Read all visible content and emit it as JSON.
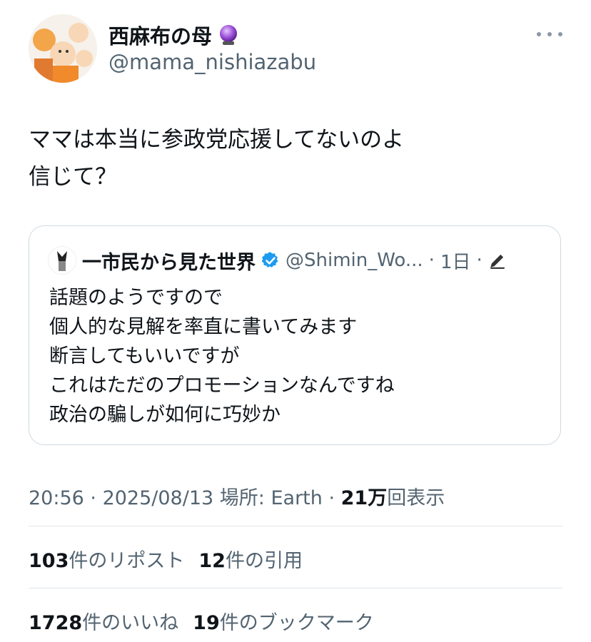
{
  "author": {
    "display_name": "西麻布の母",
    "handle": "@mama_nishiazabu",
    "emoji_icon": "crystal-ball-icon"
  },
  "tweet": {
    "text": "ママは本当に参政党応援してないのよ\n信じて？"
  },
  "quote": {
    "name": "一市民から見た世界",
    "handle": "@Shimin_Wo...",
    "time": "1日",
    "separator": "·",
    "text": "話題のようですので\n個人的な見解を率直に書いてみます\n断言してもいいですが\nこれはただのプロモーションなんですね\n政治の騙しが如何に巧妙か"
  },
  "meta": {
    "time": "20:56",
    "date": "2025/08/13",
    "location": "場所: Earth",
    "views": "21万",
    "views_label": "回表示",
    "sep": " · "
  },
  "stats": {
    "reposts": "103",
    "reposts_label": "件のリポスト",
    "quotes": "12",
    "quotes_label": "件の引用",
    "likes": "1728",
    "likes_label": "件のいいね",
    "bookmarks": "19",
    "bookmarks_label": "件のブックマーク"
  },
  "colors": {
    "text": "#0f1419",
    "secondary": "#536471",
    "verified": "#1d9bf0",
    "border": "#cfd9de"
  }
}
